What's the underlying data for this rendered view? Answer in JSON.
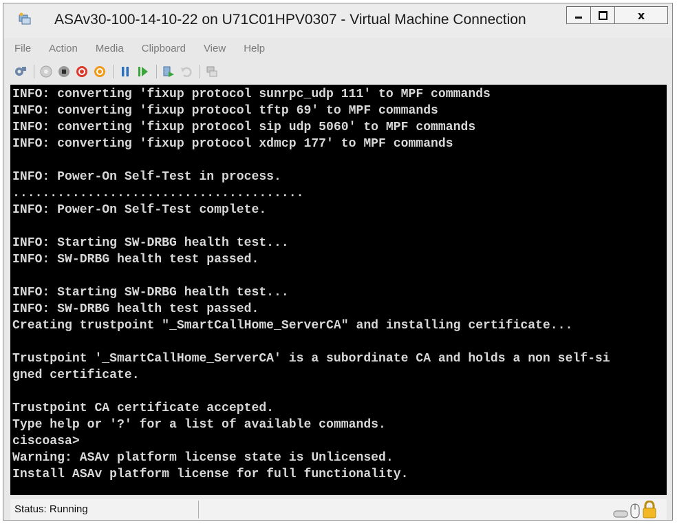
{
  "window": {
    "title": "ASAv30-100-14-10-22 on U71C01HPV0307 - Virtual Machine Connection",
    "app_icon": "vm-connection-icon",
    "controls": {
      "minimize": "minimize-icon",
      "maximize": "maximize-icon",
      "close_label": "x"
    }
  },
  "menu": [
    "File",
    "Action",
    "Media",
    "Clipboard",
    "View",
    "Help"
  ],
  "toolbar": [
    "ctrl-alt-del-icon",
    "start-icon",
    "turn-off-icon",
    "shutdown-icon",
    "power-icon",
    "pause-icon",
    "resume-icon",
    "checkpoint-icon",
    "revert-icon",
    "enhanced-session-icon"
  ],
  "console": {
    "lines": [
      "INFO: converting 'fixup protocol sunrpc_udp 111' to MPF commands",
      "INFO: converting 'fixup protocol tftp 69' to MPF commands",
      "INFO: converting 'fixup protocol sip udp 5060' to MPF commands",
      "INFO: converting 'fixup protocol xdmcp 177' to MPF commands",
      "",
      "INFO: Power-On Self-Test in process.",
      ".......................................",
      "INFO: Power-On Self-Test complete.",
      "",
      "INFO: Starting SW-DRBG health test...",
      "INFO: SW-DRBG health test passed.",
      "",
      "INFO: Starting SW-DRBG health test...",
      "INFO: SW-DRBG health test passed.",
      "Creating trustpoint \"_SmartCallHome_ServerCA\" and installing certificate...",
      "",
      "Trustpoint '_SmartCallHome_ServerCA' is a subordinate CA and holds a non self-si",
      "gned certificate.",
      "",
      "Trustpoint CA certificate accepted.",
      "Type help or '?' for a list of available commands.",
      "ciscoasa>",
      "Warning: ASAv platform license state is Unlicensed.",
      "Install ASAv platform license for full functionality."
    ],
    "colors": {
      "background": "#000000",
      "text": "#d8d8d8"
    }
  },
  "status": {
    "text": "Status: Running",
    "icons": [
      "keyboard-icon",
      "mouse-icon",
      "lock-icon"
    ]
  }
}
